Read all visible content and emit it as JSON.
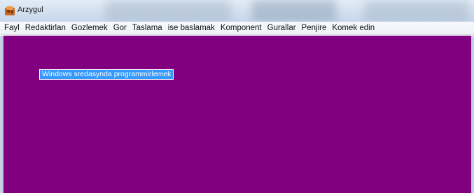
{
  "window": {
    "title": "Arzygul"
  },
  "menu": {
    "items": [
      "Fayl",
      "Redaktirlan",
      "Gozlemek",
      "Gor",
      "Taslama",
      "ise baslamak",
      "Komponent",
      "Gurallar",
      "Penjire",
      "Komek edin"
    ]
  },
  "client": {
    "background_color": "#800080",
    "label_text": "Windows sredasynda programmirlemek",
    "label_highlight_color": "#3399ff"
  },
  "icons": {
    "app": "app-icon"
  }
}
